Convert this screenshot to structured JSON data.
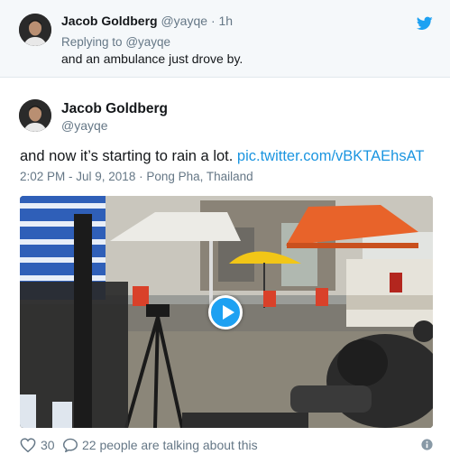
{
  "parent_tweet": {
    "name": "Jacob Goldberg",
    "handle": "@yayqe",
    "separator": "·",
    "time": "1h",
    "replying_prefix": "Replying to",
    "replying_handle": "@yayqe",
    "text": "and an ambulance just drove by.",
    "icon": "twitter-bird-icon"
  },
  "main_tweet": {
    "name": "Jacob Goldberg",
    "handle": "@yayqe",
    "text": "and now it’s starting to rain a lot.",
    "link": "pic.twitter.com/vBKTAEhsAT",
    "meta": "2:02 PM - Jul 9, 2018 · Pong Pha, Thailand",
    "media": {
      "type": "video",
      "play_icon": "play-icon"
    }
  },
  "actions": {
    "like_count": "30",
    "talking": "22 people are talking about this",
    "icons": [
      "heart-icon",
      "reply-icon",
      "info-icon"
    ]
  },
  "colors": {
    "link": "#1b95e0",
    "secondary_text": "#657786",
    "brand": "#1da1f2",
    "parent_bg": "#f5f8fa"
  }
}
